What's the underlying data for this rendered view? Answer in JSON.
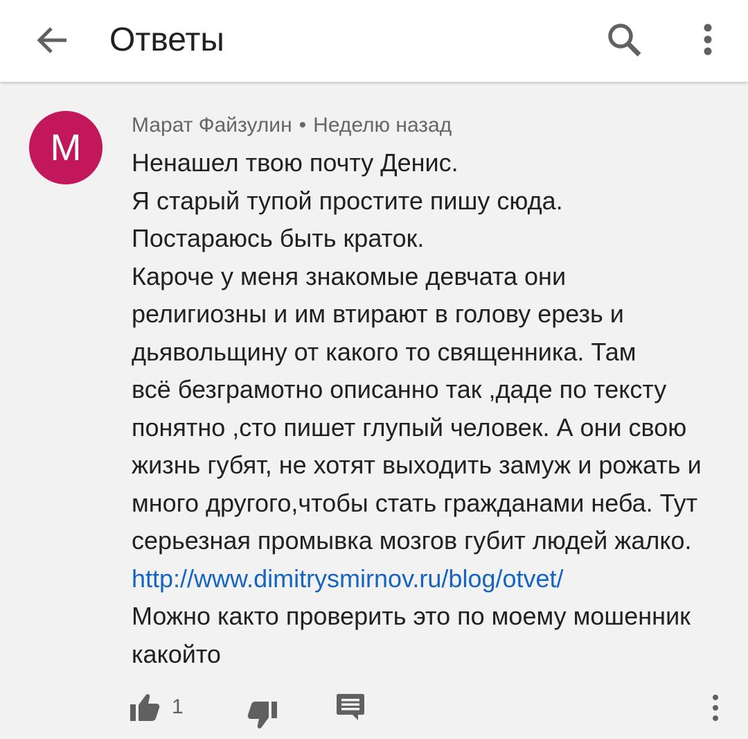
{
  "header": {
    "title": "Ответы",
    "back_icon": "arrow-back-icon",
    "search_icon": "search-icon",
    "more_icon": "more-vertical-icon"
  },
  "comment": {
    "avatar_letter": "М",
    "avatar_color": "#c2185b",
    "author": "Марат Файзулин",
    "separator": "•",
    "time": "Неделю назад",
    "lines": [
      "Ненашел твою почту Денис.",
      "Я старый тупой простите пишу сюда.",
      "Постараюсь быть краток.",
      "Кароче у меня знакомые девчата  они",
      "религиозны и им втирают в голову ерезь и",
      "дьявольщину от какого то священника. Там",
      "всё безграмотно описанно так ,даде по тексту",
      "понятно ,сто пишет глупый человек. А они свою",
      "жизнь губят, не хотят выходить замуж и рожать и",
      "много другого,чтобы стать гражданами неба. Тут",
      "серьезная промывка мозгов губит людей жалко."
    ],
    "link": "http://www.dimitrysmirnov.ru/blog/otvet/",
    "tail_lines": [
      "Можно както проверить это по моему мошенник",
      "какойто"
    ],
    "link_color": "#1565c0"
  },
  "actions": {
    "like_icon": "thumb-up-icon",
    "like_count": "1",
    "dislike_icon": "thumb-down-icon",
    "reply_icon": "reply-comment-icon",
    "more_icon": "more-vertical-icon"
  }
}
